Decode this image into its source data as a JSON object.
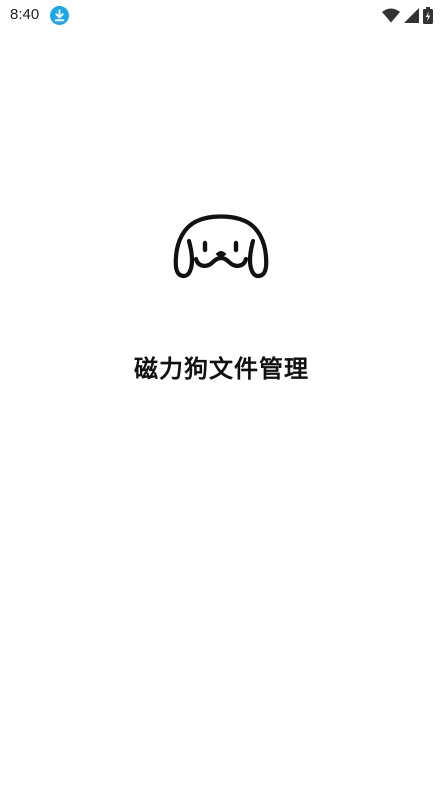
{
  "status_bar": {
    "time": "8:40",
    "notification_icon": "download-icon",
    "wifi_icon": "wifi-icon",
    "signal_icon": "cellular-signal-icon",
    "battery_icon": "battery-charging-icon",
    "accent_color": "#1aa7ec"
  },
  "splash": {
    "logo_icon": "dog-face-logo-icon",
    "app_name": "磁力狗文件管理"
  }
}
